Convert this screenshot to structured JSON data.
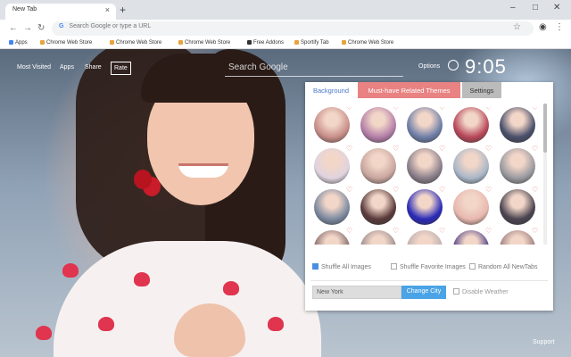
{
  "browser": {
    "tab_title": "New Tab",
    "tab_close": "×",
    "new_tab": "+",
    "win_min": "–",
    "win_max": "□",
    "win_close": "✕",
    "address_placeholder": "Search Google or type a URL",
    "google_letter": "G",
    "bookmarks": [
      {
        "label": "Apps",
        "icon": "apps-grid-icon",
        "color": "#4285f4"
      },
      {
        "label": "Chrome Web Store",
        "icon": "webstore-icon",
        "color": "#e8a33d"
      },
      {
        "label": "Chrome Web Store",
        "icon": "webstore-icon",
        "color": "#e8a33d"
      },
      {
        "label": "Chrome Web Store",
        "icon": "webstore-icon",
        "color": "#e8a33d"
      },
      {
        "label": "Free Addons",
        "icon": "addon-icon",
        "color": "#333333"
      },
      {
        "label": "Sportify Tab",
        "icon": "sportify-icon",
        "color": "#e8a33d"
      },
      {
        "label": "Chrome Web Store",
        "icon": "webstore-icon",
        "color": "#e8a33d"
      }
    ]
  },
  "page": {
    "nav": {
      "most_visited": "Most Visited",
      "apps": "Apps",
      "share": "Share",
      "rate": "Rate"
    },
    "search_placeholder": "Search Google",
    "options": "Options",
    "clock": "9:05",
    "support": "Support"
  },
  "panel": {
    "tabs": {
      "background": "Background",
      "related": "Must-have Related Themes",
      "settings": "Settings"
    },
    "thumbnail_colors": [
      "#c98f8a",
      "#b57fa8",
      "#6f7fa8",
      "#b8485a",
      "#4a4f6b",
      "#e0d4e0",
      "#c9a79f",
      "#8a7f8a",
      "#aab7c8",
      "#9a9aa0",
      "#7c8aa0",
      "#5a3a3a",
      "#2a2ab8",
      "#e8b8b0",
      "#4a4450",
      "#8a7070",
      "#a09090",
      "#c0b0b0",
      "#5a4a8a",
      "#a08080"
    ],
    "heart": "♡",
    "options": {
      "shuffle_all": "Shuffle All Images",
      "shuffle_favorite": "Shuffle Favorite Images",
      "random_all": "Random All NewTabs"
    },
    "city_value": "New York",
    "change_city": "Change City",
    "disable_weather": "Disable Weather"
  }
}
